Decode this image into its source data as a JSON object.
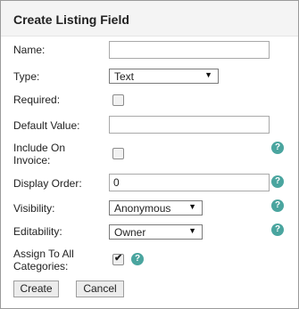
{
  "title": "Create Listing Field",
  "fields": {
    "name": {
      "label": "Name:",
      "value": ""
    },
    "type": {
      "label": "Type:",
      "value": "Text"
    },
    "required": {
      "label": "Required:",
      "checked": false
    },
    "default_value": {
      "label": "Default Value:",
      "value": ""
    },
    "include_on_invoice": {
      "label_line1": "Include On",
      "label_line2": "Invoice:",
      "checked": false
    },
    "display_order": {
      "label": "Display Order:",
      "value": "0"
    },
    "visibility": {
      "label": "Visibility:",
      "value": "Anonymous"
    },
    "editability": {
      "label": "Editability:",
      "value": "Owner"
    },
    "assign_all": {
      "label_line1": "Assign To All",
      "label_line2": "Categories:",
      "checked": true
    }
  },
  "help_glyph": "?",
  "dropdown_arrow": "▼",
  "check_glyph": "✔",
  "buttons": {
    "create": "Create",
    "cancel": "Cancel"
  },
  "colors": {
    "help": "#4aa59f",
    "header_bg": "#f4f4f4"
  }
}
